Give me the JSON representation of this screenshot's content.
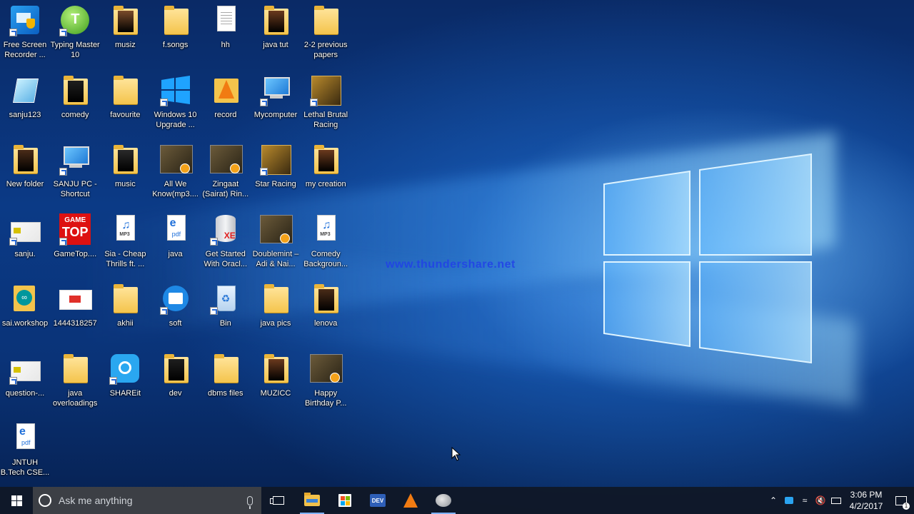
{
  "desktop": {
    "icons": [
      {
        "label": "Free Screen Recorder ...",
        "glyph": "screen-recorder-icon"
      },
      {
        "label": "Typing Master 10",
        "glyph": "typing-master-icon"
      },
      {
        "label": "musiz",
        "glyph": "folder-icon"
      },
      {
        "label": "f.songs",
        "glyph": "folder-icon"
      },
      {
        "label": "hh",
        "glyph": "text-document-icon"
      },
      {
        "label": "java tut",
        "glyph": "folder-icon"
      },
      {
        "label": "2-2 previous papers",
        "glyph": "folder-icon"
      },
      {
        "label": "sanju123",
        "glyph": "notepad-icon"
      },
      {
        "label": "comedy",
        "glyph": "folder-icon"
      },
      {
        "label": "favourite",
        "glyph": "folder-icon"
      },
      {
        "label": "Windows 10 Upgrade ...",
        "glyph": "windows-icon"
      },
      {
        "label": "record",
        "glyph": "vlc-icon"
      },
      {
        "label": "Mycomputer",
        "glyph": "computer-icon"
      },
      {
        "label": "Lethal Brutal Racing",
        "glyph": "game-icon"
      },
      {
        "label": "New folder",
        "glyph": "folder-icon"
      },
      {
        "label": "SANJU PC - Shortcut",
        "glyph": "computer-icon"
      },
      {
        "label": "music",
        "glyph": "folder-icon"
      },
      {
        "label": "All We Know(mp3....",
        "glyph": "video-icon"
      },
      {
        "label": "Zingaat (Sairat) Rin...",
        "glyph": "video-icon"
      },
      {
        "label": "Star Racing",
        "glyph": "game-icon"
      },
      {
        "label": "my creation",
        "glyph": "folder-icon"
      },
      {
        "label": "sanju.",
        "glyph": "image-icon"
      },
      {
        "label": "GameTop....",
        "glyph": "gametop-icon"
      },
      {
        "label": "Sia - Cheap Thrills ft. ...",
        "glyph": "mp3-icon"
      },
      {
        "label": "java",
        "glyph": "pdf-icon"
      },
      {
        "label": "Get Started With Oracl...",
        "glyph": "database-icon"
      },
      {
        "label": "Doublemint – Adi & Nai...",
        "glyph": "video-icon"
      },
      {
        "label": "Comedy Backgroun...",
        "glyph": "mp3-icon"
      },
      {
        "label": "sai.workshop",
        "glyph": "arduino-icon"
      },
      {
        "label": "1444318257",
        "glyph": "java-image-icon"
      },
      {
        "label": "akhii",
        "glyph": "folder-icon"
      },
      {
        "label": "soft",
        "glyph": "shareit-folder-icon"
      },
      {
        "label": "Bin",
        "glyph": "recycle-bin-icon"
      },
      {
        "label": "java pics",
        "glyph": "folder-icon"
      },
      {
        "label": "lenova",
        "glyph": "folder-icon"
      },
      {
        "label": "question-...",
        "glyph": "image-icon"
      },
      {
        "label": "java overloadings",
        "glyph": "folder-icon"
      },
      {
        "label": "SHAREit",
        "glyph": "shareit-icon"
      },
      {
        "label": "dev",
        "glyph": "folder-icon"
      },
      {
        "label": "dbms files",
        "glyph": "folder-icon"
      },
      {
        "label": "MUZICC",
        "glyph": "folder-icon"
      },
      {
        "label": "Happy Birthday P...",
        "glyph": "video-icon"
      },
      {
        "label": "JNTUH B.Tech CSE...",
        "glyph": "pdf-icon"
      }
    ],
    "watermark": "www.thundershare.net"
  },
  "taskbar": {
    "search_placeholder": "Ask me anything",
    "dev_label": "DEV",
    "clock_time": "3:06 PM",
    "clock_date": "4/2/2017",
    "notification_count": "1"
  },
  "colors": {
    "accent": "#7fb3ff",
    "taskbar": "#101828",
    "folder": "#f4c44c"
  }
}
